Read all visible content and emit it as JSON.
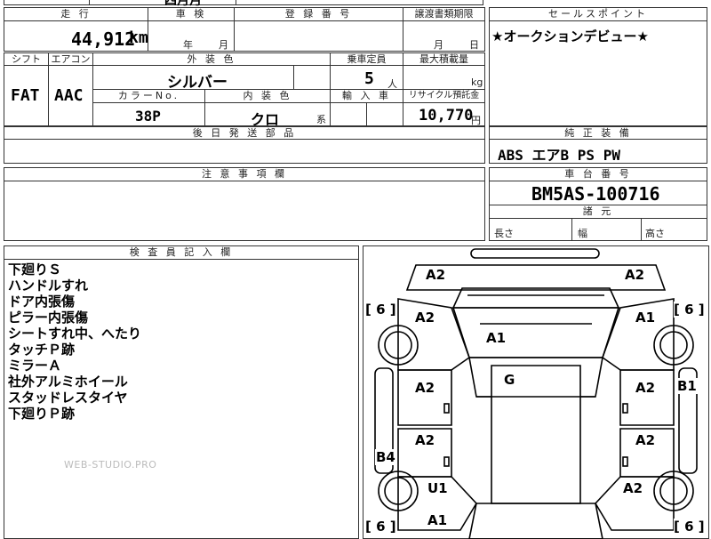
{
  "top_strip": {
    "partial_text": "四月月"
  },
  "headers": {
    "mileage": "走 行",
    "inspection": "車 検",
    "registration": "登 録 番 号",
    "transfer_deadline": "譲渡書類期限",
    "sales_point": "セールスポイント",
    "shift": "シフト",
    "aircon": "エアコン",
    "exterior_color": "外 装 色",
    "capacity": "乗車定員",
    "max_load": "最大積載量",
    "color_no": "カラーNo.",
    "interior_color": "内 装 色",
    "import": "輸 入 車",
    "recycle": "リサイクル預託金",
    "later_parts": "後 日 発 送 部 品",
    "standard_equipment": "純 正 装 備",
    "caution": "注 意 事 項 欄",
    "chassis_no": "車 台 番 号",
    "dimensions": "諸 元",
    "inspector": "検 査 員 記 入 欄"
  },
  "values": {
    "mileage": "44,912",
    "mileage_unit": "km",
    "inspection_year_label": "年",
    "inspection_month_label": "月",
    "transfer_month_label": "月",
    "transfer_day_label": "日",
    "sales_point_text": "★オークションデビュー★",
    "shift": "FAT",
    "aircon": "AAC",
    "exterior_color": "シルバー",
    "capacity": "5",
    "capacity_unit": "人",
    "max_load_unit": "kg",
    "color_no": "38P",
    "interior_color": "クロ",
    "interior_suffix": "系",
    "recycle": "10,770",
    "recycle_unit": "円",
    "standard_equipment": "ABS エアB PS PW",
    "chassis_no": "BM5AS-100716",
    "length_label": "長さ",
    "width_label": "幅",
    "height_label": "高さ"
  },
  "inspector_notes": [
    "下廻りＳ",
    "ハンドルすれ",
    "ドア内張傷",
    "ピラー内張傷",
    "シートすれ中、へたり",
    "タッチＰ跡",
    "ミラーＡ",
    "社外アルミホイール",
    "スタッドレスタイヤ",
    "下廻りＰ跡"
  ],
  "watermark": "WEB-STUDIO.PRO",
  "damage_marks": {
    "front_left": "A2",
    "front_right": "A2",
    "fender_left": "A2",
    "fender_right": "A1",
    "hood": "A1",
    "roof": "G",
    "door_fl": "A2",
    "door_fr": "A2",
    "door_rl": "A2",
    "door_rr": "A2",
    "side_right": "B1",
    "side_left": "B4",
    "rear_fender_left": "U1",
    "rear_fender_right": "A2",
    "rear_left": "A1"
  },
  "tire_brackets": {
    "fl": "[ 6 ]",
    "fr": "[ 6 ]",
    "rl": "[ 6 ]",
    "rr": "[ 6 ]"
  }
}
